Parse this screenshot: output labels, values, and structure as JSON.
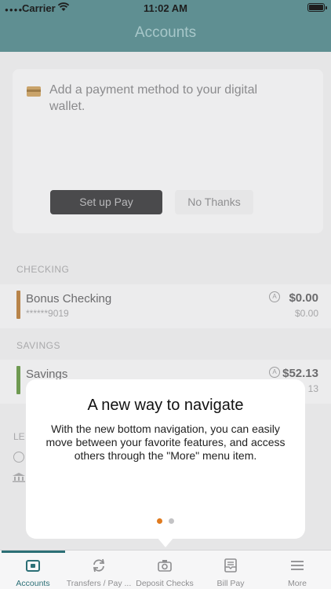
{
  "status_bar": {
    "carrier": "Carrier",
    "time": "11:02 AM"
  },
  "nav": {
    "title": "Accounts"
  },
  "wallet_card": {
    "message": "Add a payment method to your digital wallet.",
    "setup_button": "Set up  Pay",
    "no_thanks_button": "No Thanks"
  },
  "sections": {
    "checking": {
      "label": "CHECKING",
      "accounts": [
        {
          "name": "Bonus Checking",
          "number": "******9019",
          "balance": "$0.00",
          "balance_sub": "$0.00",
          "color": "#b8844a"
        }
      ]
    },
    "savings": {
      "label": "SAVINGS",
      "accounts": [
        {
          "name": "Savings",
          "balance": "$52.13",
          "balance_sub": "13",
          "color": "#6f9a52"
        }
      ]
    },
    "partial_label": "LE"
  },
  "popup": {
    "title": "A new way to navigate",
    "body": "With the new bottom navigation, you can easily move between your favorite features, and access others through the \"More\" menu item.",
    "pages": 2,
    "current_page": 1,
    "dot_active_color": "#e07b1f",
    "dot_inactive_color": "#c3c3c5"
  },
  "tabbar": {
    "accent_color": "#2c6f76",
    "items": [
      {
        "label": "Accounts",
        "icon": "wallet-icon",
        "active": true
      },
      {
        "label": "Transfers / Pay ...",
        "icon": "transfer-arrows-icon",
        "active": false
      },
      {
        "label": "Deposit Checks",
        "icon": "camera-icon",
        "active": false
      },
      {
        "label": "Bill Pay",
        "icon": "bill-icon",
        "active": false
      },
      {
        "label": "More",
        "icon": "menu-icon",
        "active": false
      }
    ]
  }
}
